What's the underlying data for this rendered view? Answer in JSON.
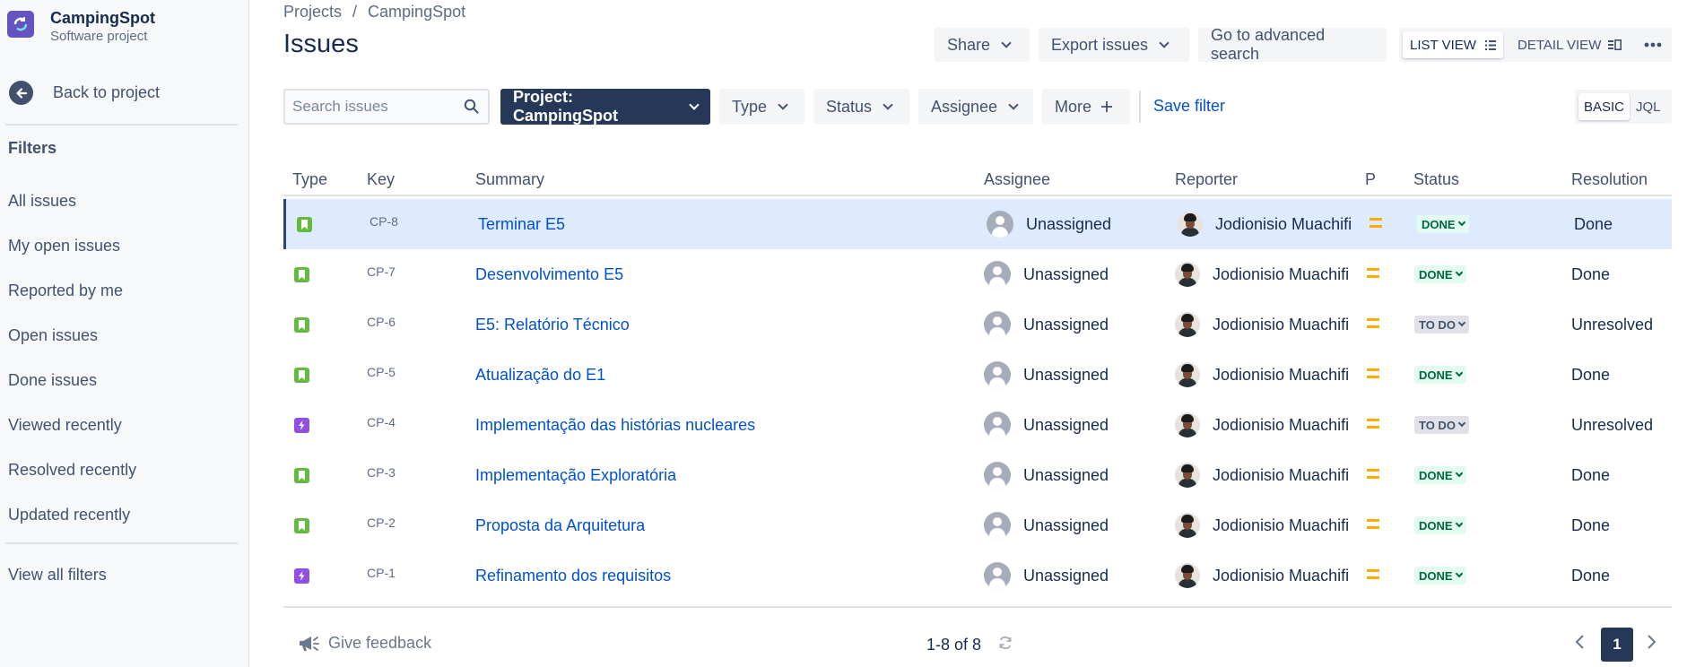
{
  "project": {
    "name": "CampingSpot",
    "type": "Software project"
  },
  "sidebar": {
    "back_label": "Back to project",
    "filters_heading": "Filters",
    "items": [
      "All issues",
      "My open issues",
      "Reported by me",
      "Open issues",
      "Done issues",
      "Viewed recently",
      "Resolved recently",
      "Updated recently"
    ],
    "view_all": "View all filters"
  },
  "breadcrumb": {
    "root": "Projects",
    "sep": "/",
    "current": "CampingSpot"
  },
  "page_title": "Issues",
  "toolbar": {
    "share": "Share",
    "export": "Export issues",
    "advanced": "Go to advanced search",
    "list_view": "LIST VIEW",
    "detail_view": "DETAIL VIEW"
  },
  "filters": {
    "search_placeholder": "Search issues",
    "project": "Project: CampingSpot",
    "type": "Type",
    "status": "Status",
    "assignee": "Assignee",
    "more": "More",
    "save_filter": "Save filter",
    "basic": "BASIC",
    "jql": "JQL"
  },
  "table": {
    "headers": {
      "type": "Type",
      "key": "Key",
      "summary": "Summary",
      "assignee": "Assignee",
      "reporter": "Reporter",
      "priority": "P",
      "status": "Status",
      "resolution": "Resolution"
    },
    "rows": [
      {
        "type": "story",
        "key": "CP-8",
        "summary": "Terminar E5",
        "assignee": "Unassigned",
        "reporter": "Jodionisio Muachifi",
        "status": "DONE",
        "resolution": "Done"
      },
      {
        "type": "story",
        "key": "CP-7",
        "summary": "Desenvolvimento E5",
        "assignee": "Unassigned",
        "reporter": "Jodionisio Muachifi",
        "status": "DONE",
        "resolution": "Done"
      },
      {
        "type": "story",
        "key": "CP-6",
        "summary": "E5: Relatório Técnico",
        "assignee": "Unassigned",
        "reporter": "Jodionisio Muachifi",
        "status": "TO DO",
        "resolution": "Unresolved"
      },
      {
        "type": "story",
        "key": "CP-5",
        "summary": "Atualização do E1",
        "assignee": "Unassigned",
        "reporter": "Jodionisio Muachifi",
        "status": "DONE",
        "resolution": "Done"
      },
      {
        "type": "epic",
        "key": "CP-4",
        "summary": "Implementação das histórias nucleares",
        "assignee": "Unassigned",
        "reporter": "Jodionisio Muachifi",
        "status": "TO DO",
        "resolution": "Unresolved"
      },
      {
        "type": "story",
        "key": "CP-3",
        "summary": "Implementação Exploratória",
        "assignee": "Unassigned",
        "reporter": "Jodionisio Muachifi",
        "status": "DONE",
        "resolution": "Done"
      },
      {
        "type": "story",
        "key": "CP-2",
        "summary": "Proposta da Arquitetura",
        "assignee": "Unassigned",
        "reporter": "Jodionisio Muachifi",
        "status": "DONE",
        "resolution": "Done"
      },
      {
        "type": "epic",
        "key": "CP-1",
        "summary": "Refinamento dos requisitos",
        "assignee": "Unassigned",
        "reporter": "Jodionisio Muachifi",
        "status": "DONE",
        "resolution": "Done"
      }
    ]
  },
  "footer": {
    "feedback": "Give feedback",
    "count": "1-8 of 8",
    "page": "1"
  },
  "colors": {
    "accent": "#0052cc",
    "primary_button": "#253858",
    "story": "#63ba3c",
    "epic": "#904ee2",
    "priority_medium": "#ffab00",
    "selected_row": "#deebff"
  }
}
